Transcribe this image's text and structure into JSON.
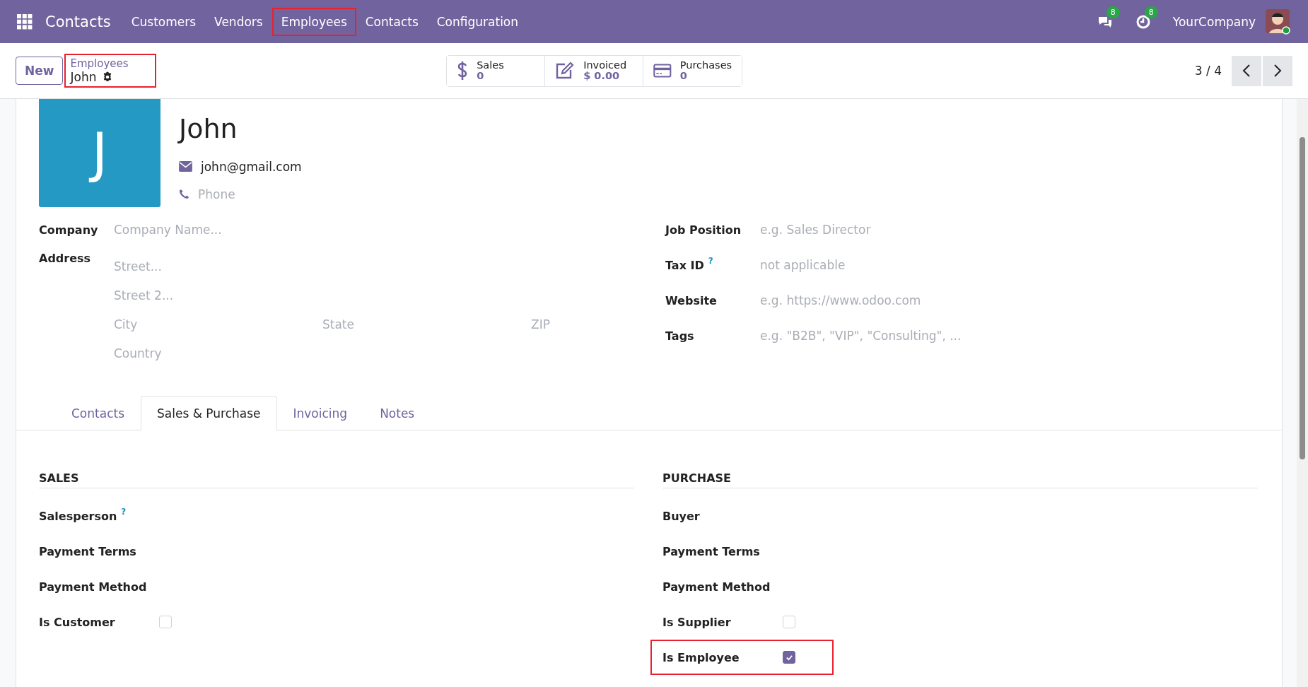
{
  "navbar": {
    "app_name": "Contacts",
    "menu": [
      {
        "label": "Customers",
        "highlighted": false
      },
      {
        "label": "Vendors",
        "highlighted": false
      },
      {
        "label": "Employees",
        "highlighted": true
      },
      {
        "label": "Contacts",
        "highlighted": false
      },
      {
        "label": "Configuration",
        "highlighted": false
      }
    ],
    "messages_badge": "8",
    "activities_badge": "8",
    "company": "YourCompany"
  },
  "control_panel": {
    "new_button": "New",
    "breadcrumb": {
      "parent": "Employees",
      "current": "John",
      "highlighted": true
    },
    "stat_buttons": [
      {
        "kind": "sales",
        "label": "Sales",
        "value": "0"
      },
      {
        "kind": "invoiced",
        "label": "Invoiced",
        "value": "$ 0.00"
      },
      {
        "kind": "purchases",
        "label": "Purchases",
        "value": "0"
      }
    ],
    "pager": "3 / 4"
  },
  "form": {
    "avatar_letter": "J",
    "name": "John",
    "email": "john@gmail.com",
    "phone": {
      "placeholder": "Phone"
    },
    "company": {
      "label": "Company",
      "placeholder": "Company Name..."
    },
    "address": {
      "label": "Address",
      "street": {
        "placeholder": "Street..."
      },
      "street2": {
        "placeholder": "Street 2..."
      },
      "city": {
        "placeholder": "City"
      },
      "state": {
        "placeholder": "State"
      },
      "zip": {
        "placeholder": "ZIP"
      },
      "country": {
        "placeholder": "Country"
      }
    },
    "right_fields": [
      {
        "label": "Job Position",
        "placeholder": "e.g. Sales Director"
      },
      {
        "label": "Tax ID",
        "help": "?",
        "placeholder": "not applicable"
      },
      {
        "label": "Website",
        "placeholder": "e.g. https://www.odoo.com"
      },
      {
        "label": "Tags",
        "placeholder": "e.g. \"B2B\", \"VIP\", \"Consulting\", ..."
      }
    ],
    "tabs": [
      {
        "label": "Contacts",
        "selected": false
      },
      {
        "label": "Sales & Purchase",
        "selected": true
      },
      {
        "label": "Invoicing",
        "selected": false
      },
      {
        "label": "Notes",
        "selected": false
      }
    ],
    "sections": [
      {
        "title": "SALES",
        "rows": [
          {
            "kind": "field",
            "label": "Salesperson",
            "help": "?"
          },
          {
            "kind": "field",
            "label": "Payment Terms"
          },
          {
            "kind": "field",
            "label": "Payment Method"
          },
          {
            "kind": "checkbox",
            "label": "Is Customer",
            "checked": false,
            "highlighted": false
          }
        ]
      },
      {
        "title": "PURCHASE",
        "rows": [
          {
            "kind": "field",
            "label": "Buyer"
          },
          {
            "kind": "field",
            "label": "Payment Terms"
          },
          {
            "kind": "field",
            "label": "Payment Method"
          },
          {
            "kind": "checkbox",
            "label": "Is Supplier",
            "checked": false,
            "highlighted": false
          },
          {
            "kind": "checkbox",
            "label": "Is Employee",
            "checked": true,
            "highlighted": true
          }
        ]
      }
    ]
  }
}
